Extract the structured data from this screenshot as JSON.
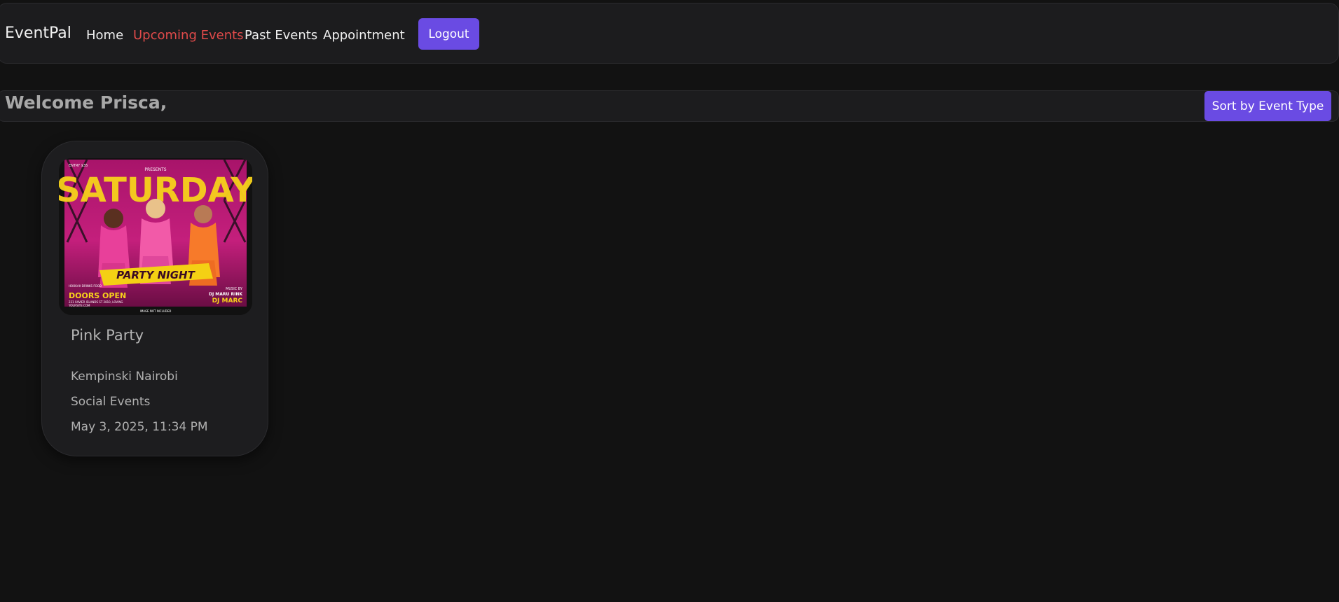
{
  "navbar": {
    "brand": "EventPal",
    "links": [
      "Home",
      "Upcoming Events",
      "Past Events",
      "Appointment"
    ],
    "active_link": "Upcoming Events",
    "logout_label": "Logout"
  },
  "welcome": {
    "text": "Welcome Prisca,",
    "sort_label": "Sort by Event Type"
  },
  "events": [
    {
      "title": "Pink Party",
      "venue": "Kempinski Nairobi",
      "category": "Social Events",
      "datetime": "May 3, 2025, 11:34 PM",
      "poster": {
        "presents": "PRESENTS",
        "headline": "SATURDAY",
        "tagline": "PARTY NIGHT",
        "entry": "ENTRY $35",
        "extras": "HOOKAH DRINKS FOOD",
        "music_by": "MUSIC BY",
        "dj1": "DJ MARU RINK",
        "dj2": "DJ MARC",
        "doors": "DOORS OPEN",
        "address": "231 XAVIER ISLANDS ST 2810, LOVING",
        "site": "YOURSITE.COM",
        "note": "IMAGE NOT INCLUDED"
      }
    }
  ],
  "colors": {
    "background": "#121212",
    "surface": "#1c1c1e",
    "accent": "#6a4be3",
    "active_link": "#e04a4a"
  }
}
